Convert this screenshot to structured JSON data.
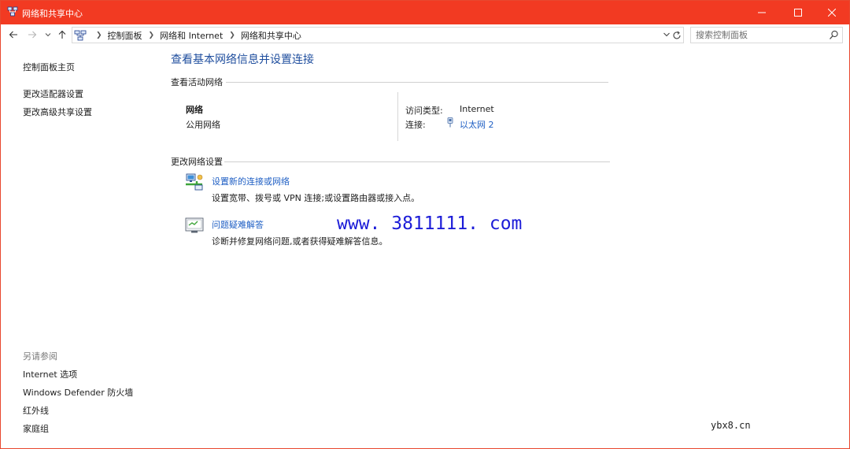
{
  "window": {
    "title": "网络和共享中心",
    "accent_color": "#f23a22",
    "app_icon": "network-center-icon"
  },
  "nav": {
    "breadcrumbs": [
      "控制面板",
      "网络和 Internet",
      "网络和共享中心"
    ],
    "search_placeholder": "搜索控制面板"
  },
  "sidebar": {
    "links": [
      "控制面板主页",
      "更改适配器设置",
      "更改高级共享设置"
    ],
    "see_also_heading": "另请参阅",
    "see_also_links": [
      "Internet 选项",
      "Windows Defender 防火墙",
      "红外线",
      "家庭组"
    ]
  },
  "main": {
    "title": "查看基本网络信息并设置连接",
    "active_networks_heading": "查看活动网络",
    "network": {
      "name": "网络",
      "type": "公用网络",
      "access_type_label": "访问类型:",
      "access_type_value": "Internet",
      "connection_label": "连接:",
      "connection_value": "以太网 2"
    },
    "change_settings_heading": "更改网络设置",
    "tasks": [
      {
        "link": "设置新的连接或网络",
        "desc": "设置宽带、拨号或 VPN 连接;或设置路由器或接入点。",
        "icon": "new-connection-icon"
      },
      {
        "link": "问题疑难解答",
        "desc": "诊断并修复网络问题,或者获得疑难解答信息。",
        "icon": "troubleshoot-icon"
      }
    ]
  },
  "watermarks": {
    "url": "www. 3811111. com",
    "corner": "ybx8.cn"
  }
}
